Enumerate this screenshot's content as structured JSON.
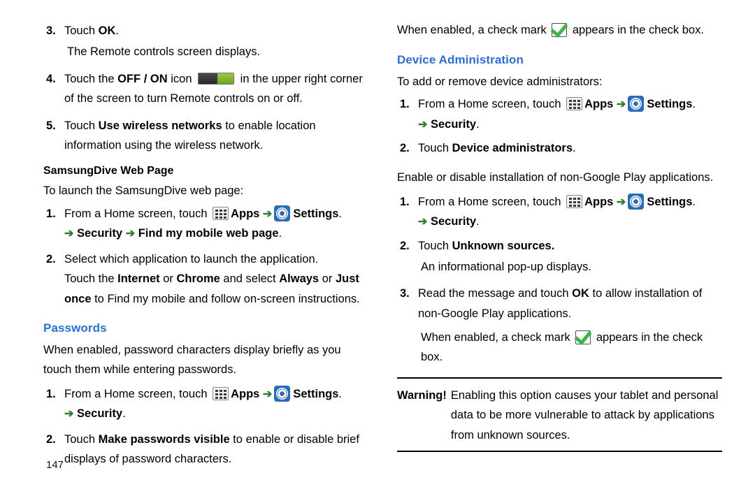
{
  "document": {
    "page_number": "147"
  },
  "left_column": {
    "step3": {
      "num": "3.",
      "pre": "Touch ",
      "bold": "OK",
      "post": "."
    },
    "step3_note": "The Remote controls screen displays.",
    "step4": {
      "num": "4.",
      "pre": "Touch the ",
      "bold": "OFF / ON",
      "mid": " icon ",
      "post": " in the upper right corner of the screen to turn Remote controls on or off."
    },
    "step5": {
      "num": "5.",
      "pre": "Touch ",
      "bold": "Use wireless networks",
      "post": " to enable location information using the wireless network."
    },
    "subheading": "SamsungDive Web Page",
    "intro": "To launch the SamsungDive web page:",
    "step1": {
      "num": "1.",
      "pre": "From a Home screen, touch ",
      "apps": "Apps",
      "settings": "Settings",
      "tail_line": "Security",
      "tail_line2": "Find my mobile web page",
      "period": "."
    },
    "step2": {
      "num": "2.",
      "line1": "Select which application to launch the application.",
      "line2_pre": "Touch the ",
      "internet": "Internet",
      "or1": " or ",
      "chrome": "Chrome",
      "mid": " and select ",
      "always": "Always",
      "or2": " or ",
      "justonce": "Just once",
      "line3": " to Find my mobile and follow on-screen instructions."
    },
    "passwords_heading": "Passwords",
    "passwords_para": "When enabled, password characters display briefly as you touch them while entering passwords.",
    "pw_step1": {
      "num": "1.",
      "pre": "From a Home screen, touch ",
      "apps": "Apps",
      "settings": "Settings",
      "tail": "Security",
      "period": "."
    },
    "pw_step2": {
      "num": "2.",
      "pre": "Touch ",
      "bold": "Make passwords visible",
      "post": " to enable or disable brief displays of password characters."
    }
  },
  "right_column": {
    "checkmark_note": {
      "pre": "When enabled, a check mark ",
      "post": " appears in the check box."
    },
    "device_admin_heading": "Device Administration",
    "device_admin_intro": "To add or remove device administrators:",
    "da_step1": {
      "num": "1.",
      "pre": "From a Home screen, touch ",
      "apps": "Apps",
      "settings": "Settings",
      "tail": "Security",
      "period": "."
    },
    "da_step2": {
      "num": "2.",
      "pre": "Touch ",
      "bold": "Device administrators",
      "post": "."
    },
    "enable_para": "Enable or disable installation of non-Google Play applications.",
    "en_step1": {
      "num": "1.",
      "pre": "From a Home screen, touch ",
      "apps": "Apps",
      "settings": "Settings",
      "tail": "Security",
      "period": "."
    },
    "en_step2": {
      "num": "2.",
      "pre": "Touch ",
      "bold": "Unknown sources."
    },
    "en_step2_note": "An informational pop-up displays.",
    "en_step3": {
      "num": "3.",
      "pre": "Read the message and touch ",
      "bold": "OK",
      "post": " to allow installation of non-Google Play applications."
    },
    "checkmark_note2": {
      "pre": "When enabled, a check mark ",
      "post": " appears in the check box."
    },
    "warning": {
      "label": "Warning!",
      "text": "Enabling this option causes your tablet and personal data to be more vulnerable to attack by applications from unknown sources."
    }
  },
  "icons": {
    "apps": "apps-grid-icon",
    "settings": "settings-gear-icon",
    "check": "green-check-icon",
    "toggle": "off-on-toggle-icon",
    "arrow": "right-arrow-icon"
  }
}
